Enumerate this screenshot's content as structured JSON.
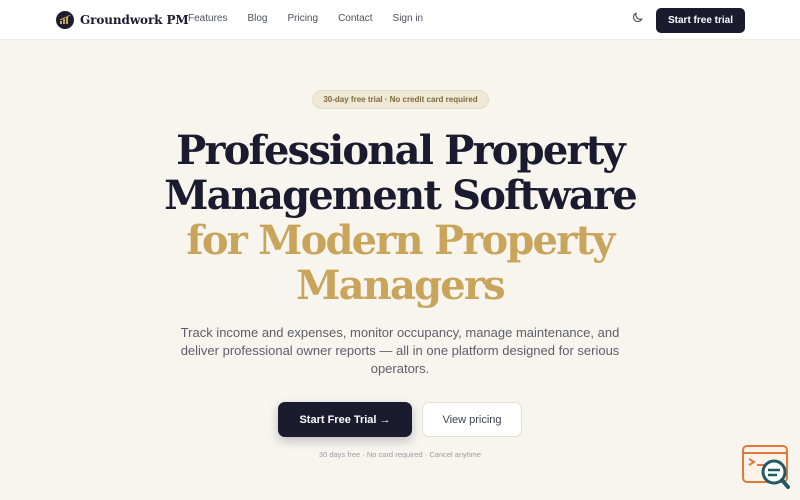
{
  "nav": {
    "brand": "Groundwork PM",
    "links": [
      "Features",
      "Blog",
      "Pricing",
      "Contact",
      "Sign in"
    ],
    "cta": "Start free trial"
  },
  "hero": {
    "badge": "30-day free trial · No credit card required",
    "headline_dark": [
      "Professional Property",
      "Management Software"
    ],
    "headline_accent": [
      "for Modern Property",
      "Managers"
    ],
    "subtitle": "Track income and expenses, monitor occupancy, manage maintenance, and deliver professional owner reports — all in one platform designed for serious operators.",
    "primary_button": "Start Free Trial →",
    "secondary_button": "View pricing",
    "fineprint": "30 days free · No card required · Cancel anytime"
  },
  "icons": {
    "logo": "bar-chart-logo-icon",
    "theme_toggle": "moon-icon",
    "widget": "chat-search-widget-icon"
  },
  "colors": {
    "background": "#f8f5ef",
    "navy": "#1a1b2e",
    "gold": "#c9a55b",
    "badge_bg": "#f0e8d6",
    "badge_text": "#7e6a3e"
  }
}
